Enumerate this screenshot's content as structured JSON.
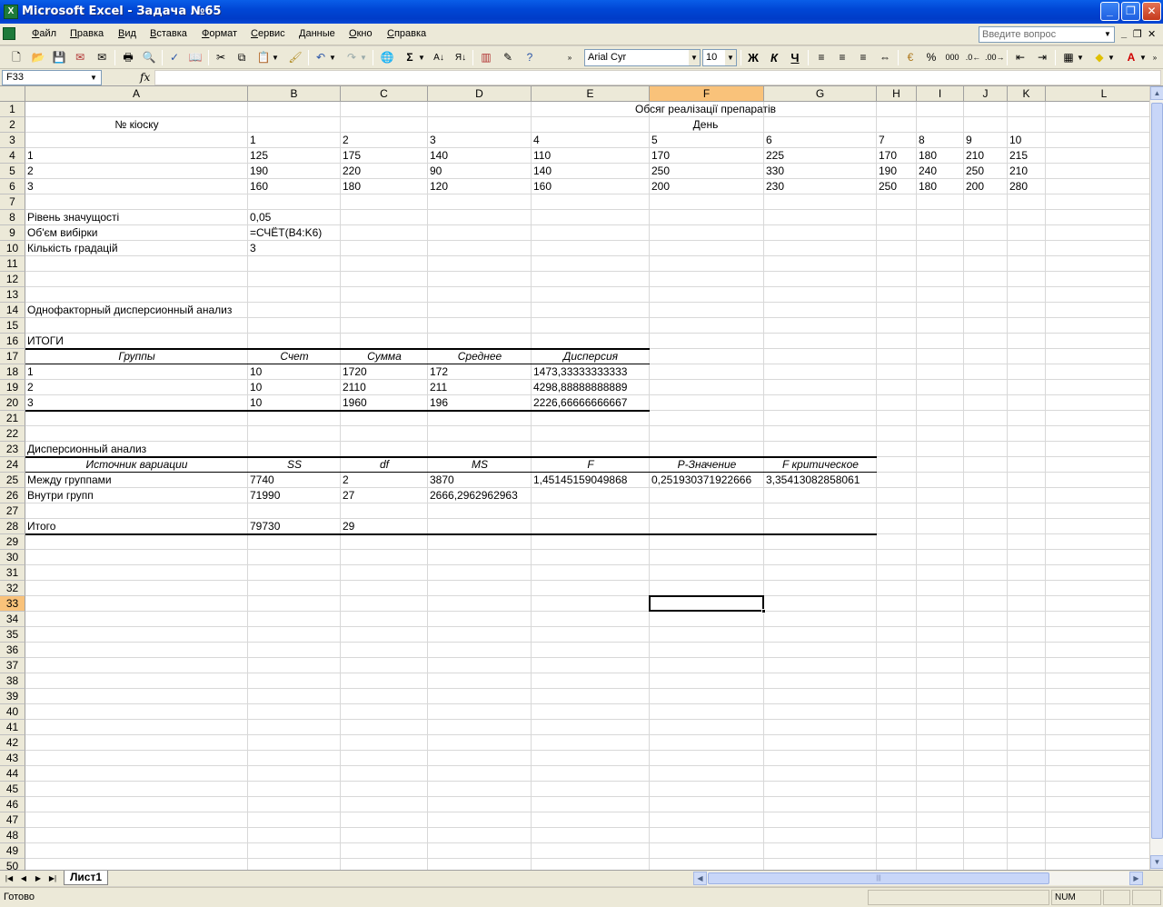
{
  "window": {
    "title": "Microsoft Excel - Задача №65",
    "app_icon": "X",
    "minimize": "_",
    "restore": "❐",
    "close": "✕"
  },
  "menu": {
    "items": [
      "Файл",
      "Правка",
      "Вид",
      "Вставка",
      "Формат",
      "Сервис",
      "Данные",
      "Окно",
      "Справка"
    ],
    "ask_placeholder": "Введите вопрос",
    "doc_minimize": "_",
    "doc_restore": "❐",
    "doc_close": "✕"
  },
  "toolbar": {
    "font_name": "Arial Cyr",
    "font_size": "10",
    "bold": "Ж",
    "italic": "К",
    "underline": "Ч",
    "percent": "%",
    "thousands": "000",
    "sum": "Σ"
  },
  "formula_bar": {
    "name_box": "F33",
    "fx_label": "fx",
    "formula": ""
  },
  "columns": [
    "A",
    "B",
    "C",
    "D",
    "E",
    "F",
    "G",
    "H",
    "I",
    "J",
    "K",
    "L"
  ],
  "active_column": "F",
  "active_row": "33",
  "rows": [
    "1",
    "2",
    "3",
    "4",
    "5",
    "6",
    "7",
    "8",
    "9",
    "10",
    "11",
    "12",
    "13",
    "14",
    "15",
    "16",
    "17",
    "18",
    "19",
    "20",
    "21",
    "22",
    "23",
    "24",
    "25",
    "26",
    "27",
    "28",
    "29",
    "30",
    "31",
    "32",
    "33",
    "34",
    "35",
    "36",
    "37",
    "38",
    "39",
    "40",
    "41",
    "42",
    "43",
    "44",
    "45",
    "46",
    "47",
    "48",
    "49",
    "50"
  ],
  "cells": {
    "r1_title": "Обсяг реалізації препаратів",
    "r2_a": "№ кіоску",
    "r2_title": "День",
    "r3": [
      "1",
      "2",
      "3",
      "4",
      "5",
      "6",
      "7",
      "8",
      "9",
      "10"
    ],
    "r4": [
      "1",
      "125",
      "175",
      "140",
      "110",
      "170",
      "225",
      "170",
      "180",
      "210",
      "215"
    ],
    "r5": [
      "2",
      "190",
      "220",
      "90",
      "140",
      "250",
      "330",
      "190",
      "240",
      "250",
      "210"
    ],
    "r6": [
      "3",
      "160",
      "180",
      "120",
      "160",
      "200",
      "230",
      "250",
      "180",
      "200",
      "280"
    ],
    "r8": [
      "Рівень значущості",
      "0,05"
    ],
    "r9": [
      "Об'єм вибірки",
      "=СЧЁТ(B4:K6)"
    ],
    "r10": [
      "Кількість градацій",
      "3"
    ],
    "r14": "Однофакторный дисперсионный анализ",
    "r16": "ИТОГИ",
    "r17": [
      "Группы",
      "Счет",
      "Сумма",
      "Среднее",
      "Дисперсия"
    ],
    "r18": [
      "1",
      "10",
      "1720",
      "172",
      "1473,33333333333"
    ],
    "r19": [
      "2",
      "10",
      "2110",
      "211",
      "4298,88888888889"
    ],
    "r20": [
      "3",
      "10",
      "1960",
      "196",
      "2226,66666666667"
    ],
    "r23": "Дисперсионный анализ",
    "r24": [
      "Источник вариации",
      "SS",
      "df",
      "MS",
      "F",
      "P-Значение",
      "F критическое"
    ],
    "r25": [
      "Между группами",
      "7740",
      "2",
      "3870",
      "1,45145159049868",
      "0,251930371922666",
      "3,35413082858061"
    ],
    "r26": [
      "Внутри групп",
      "71990",
      "27",
      "2666,2962962963"
    ],
    "r28": [
      "Итого",
      "79730",
      "29"
    ]
  },
  "sheet_tabs": [
    "Лист1"
  ],
  "status": {
    "text": "Готово",
    "num": "NUM"
  },
  "colors": {
    "title_bar": "#0046d5",
    "chrome": "#ece9d8",
    "active_header": "#f9c27a",
    "excel_green": "#1e7a3a"
  }
}
